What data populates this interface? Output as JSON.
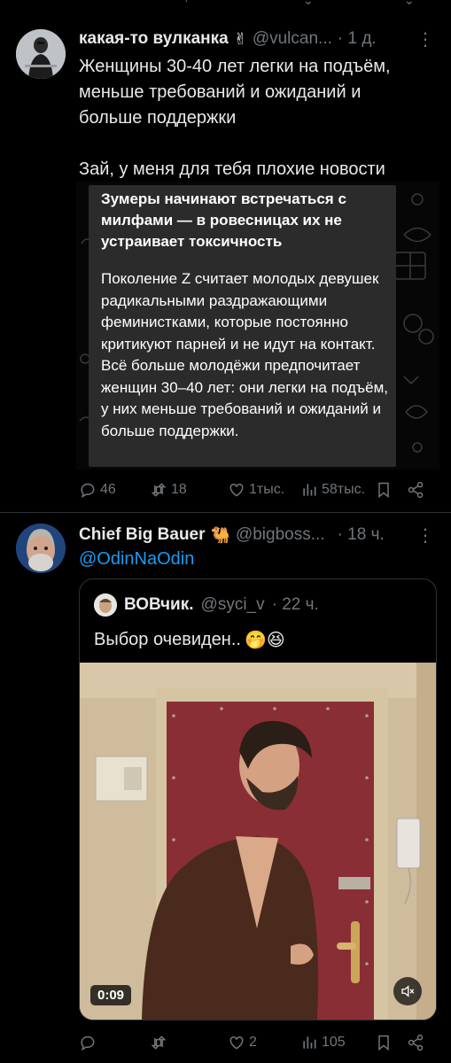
{
  "tweets": [
    {
      "name": "какая-то вулканка",
      "handle": "@vulcan...",
      "time": "· 1 д.",
      "text_lines": [
        "Женщины 30-40 лет легки на подъём,",
        "меньше требований и ожиданий и",
        "больше поддержки"
      ],
      "text_line2": "Зай, у меня для тебя плохие новости",
      "image": {
        "title": "Зумеры начинают встречаться с милфами — в ровесницах их не устраивает токсичность",
        "body": "Поколение Z считает молодых девушек радикальными раздражающими феминистками, которые постоянно критикуют парней и не идут на контакт. Всё больше молодёжи предпочитает женщин 30–40 лет: они легки на подъём, у них меньше требований и ожиданий и больше поддержки."
      },
      "actions": {
        "replies": "46",
        "reposts": "18",
        "likes": "1тыс.",
        "views": "58тыс."
      }
    },
    {
      "name": "Chief Big Bauer",
      "handle": "@bigboss...",
      "time": "· 18 ч.",
      "mention": "@OdinNaOdin",
      "quote": {
        "name": "ВОВчик.",
        "handle": "@syci_v",
        "time": "· 22 ч.",
        "text": "Выбор очевиден..",
        "emoji": "🤭😆",
        "video_time": "0:09"
      },
      "actions": {
        "replies": "",
        "reposts": "",
        "likes": "2",
        "views": "105"
      }
    }
  ],
  "colors": {
    "accent": "#1d9bf0",
    "muted": "#71767b",
    "bg": "#000000"
  },
  "icons": [
    "more-icon",
    "reply-icon",
    "repost-icon",
    "like-icon",
    "views-icon",
    "bookmark-icon",
    "share-icon",
    "mute-icon",
    "verified-hand-emoji",
    "camel-emoji"
  ]
}
